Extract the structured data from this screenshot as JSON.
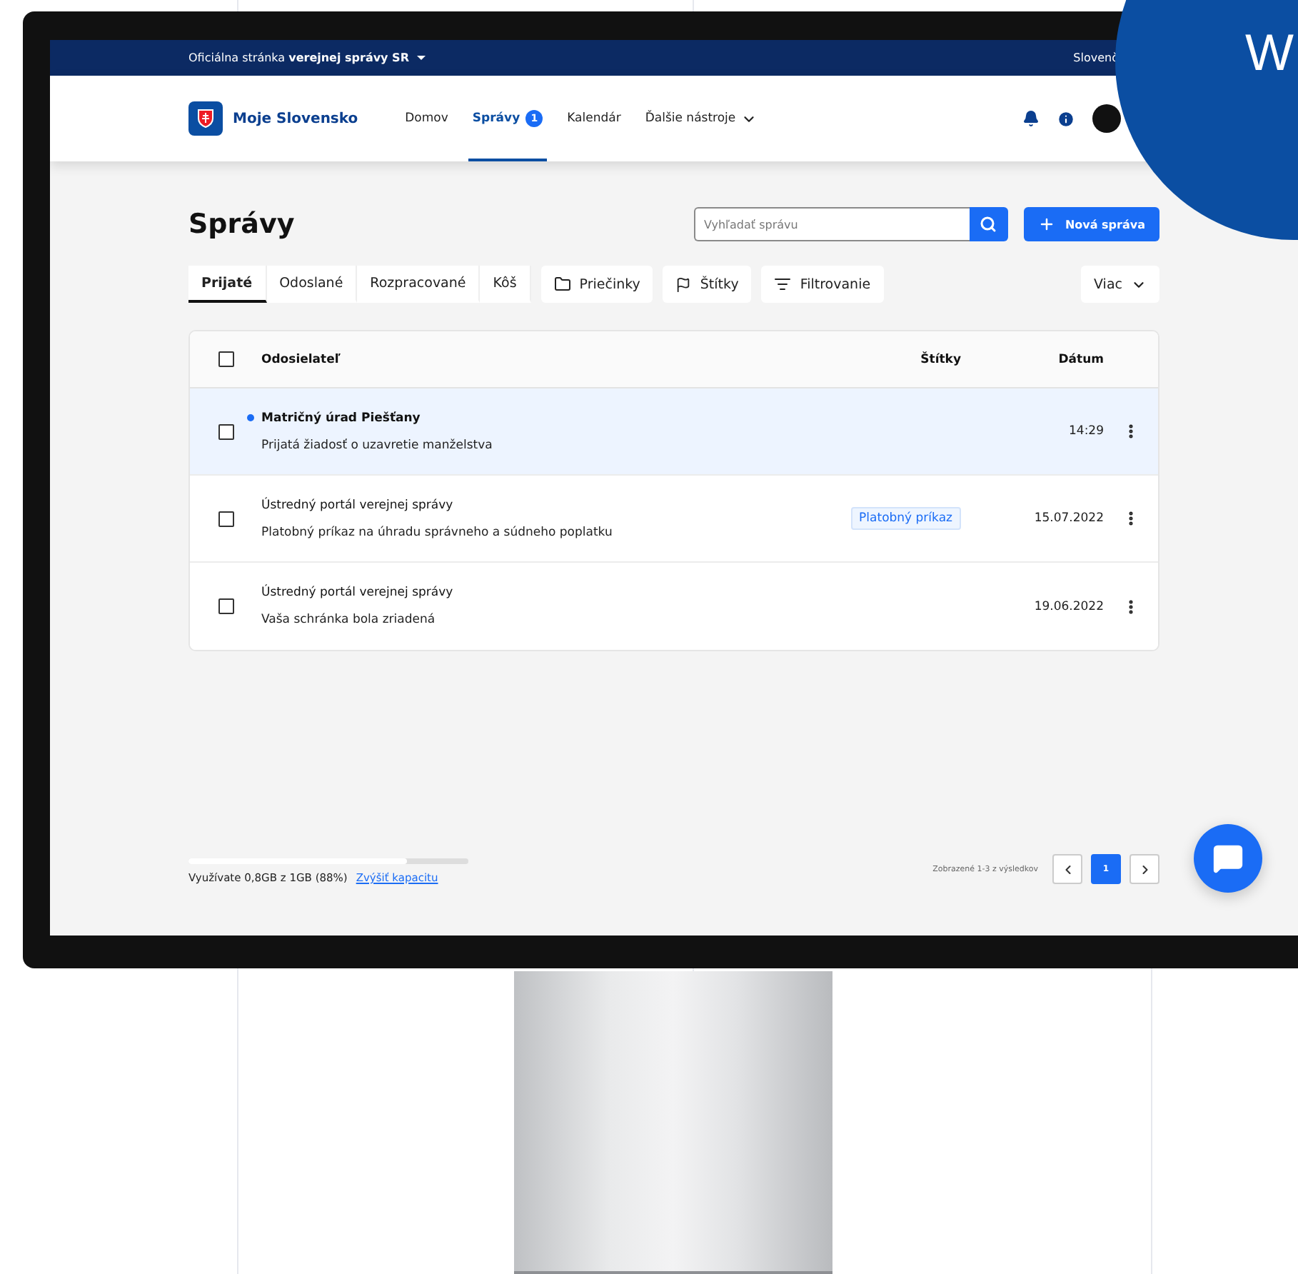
{
  "topbar": {
    "text": "Oficiálna stránka **verejnej správy SR**",
    "language": "Slovenč"
  },
  "header": {
    "logo_text": "Moje Slovensko",
    "nav": [
      {
        "label": "Domov",
        "selected": false,
        "kind": "link"
      },
      {
        "label": "Správy",
        "selected": true,
        "kind": "link",
        "badge": "1"
      },
      {
        "label": "Kalendár",
        "selected": false,
        "kind": "link"
      },
      {
        "label": "Ďalšie nástroje",
        "selected": false,
        "kind": "menu"
      }
    ]
  },
  "page_title": "Správy",
  "search": {
    "placeholder": "Vyhľadať správu"
  },
  "new_button": "Nová správa",
  "tabs": [
    {
      "label": "Prijaté",
      "selected": true
    },
    {
      "label": "Odoslané",
      "selected": false
    },
    {
      "label": "Rozpracované",
      "selected": false
    },
    {
      "label": "Kôš",
      "selected": false
    }
  ],
  "filters": [
    {
      "label": "Priečinky",
      "kind": "folder"
    },
    {
      "label": "Štítky",
      "kind": "flag"
    },
    {
      "label": "Filtrovanie",
      "kind": "filter"
    }
  ],
  "more_button": "Viac",
  "table": {
    "select_all_checked": false,
    "columns": [
      "Odosielateľ",
      "Štítky",
      "Dátum"
    ],
    "rows": [
      {
        "sender": "Matričný úrad Piešťany",
        "subject": "Prijatá žiadosť o uzavretie manželstva",
        "date": "14:29",
        "unread": true,
        "checked": false
      },
      {
        "sender": "Ústredný portál verejnej správy",
        "subject": "Platobný príkaz na úhradu správneho a súdneho poplatku",
        "tag": "Platobný príkaz",
        "date": "15.07.2022",
        "unread": false,
        "checked": false
      },
      {
        "sender": "Ústredný portál verejnej správy",
        "subject": "Vaša schránka bola zriadená",
        "date": "19.06.2022",
        "unread": false,
        "checked": false
      }
    ]
  },
  "storage": {
    "text": "Využívate 0,8GB z 1GB (88%)",
    "link": "Zvýšiť kapacitu",
    "level": 0.78
  },
  "pagination": {
    "summary": "Zobrazené 1-3 z výsledkov",
    "pages": [
      {
        "label": "1",
        "selected": true
      }
    ]
  },
  "promo": {
    "letter": "W"
  }
}
